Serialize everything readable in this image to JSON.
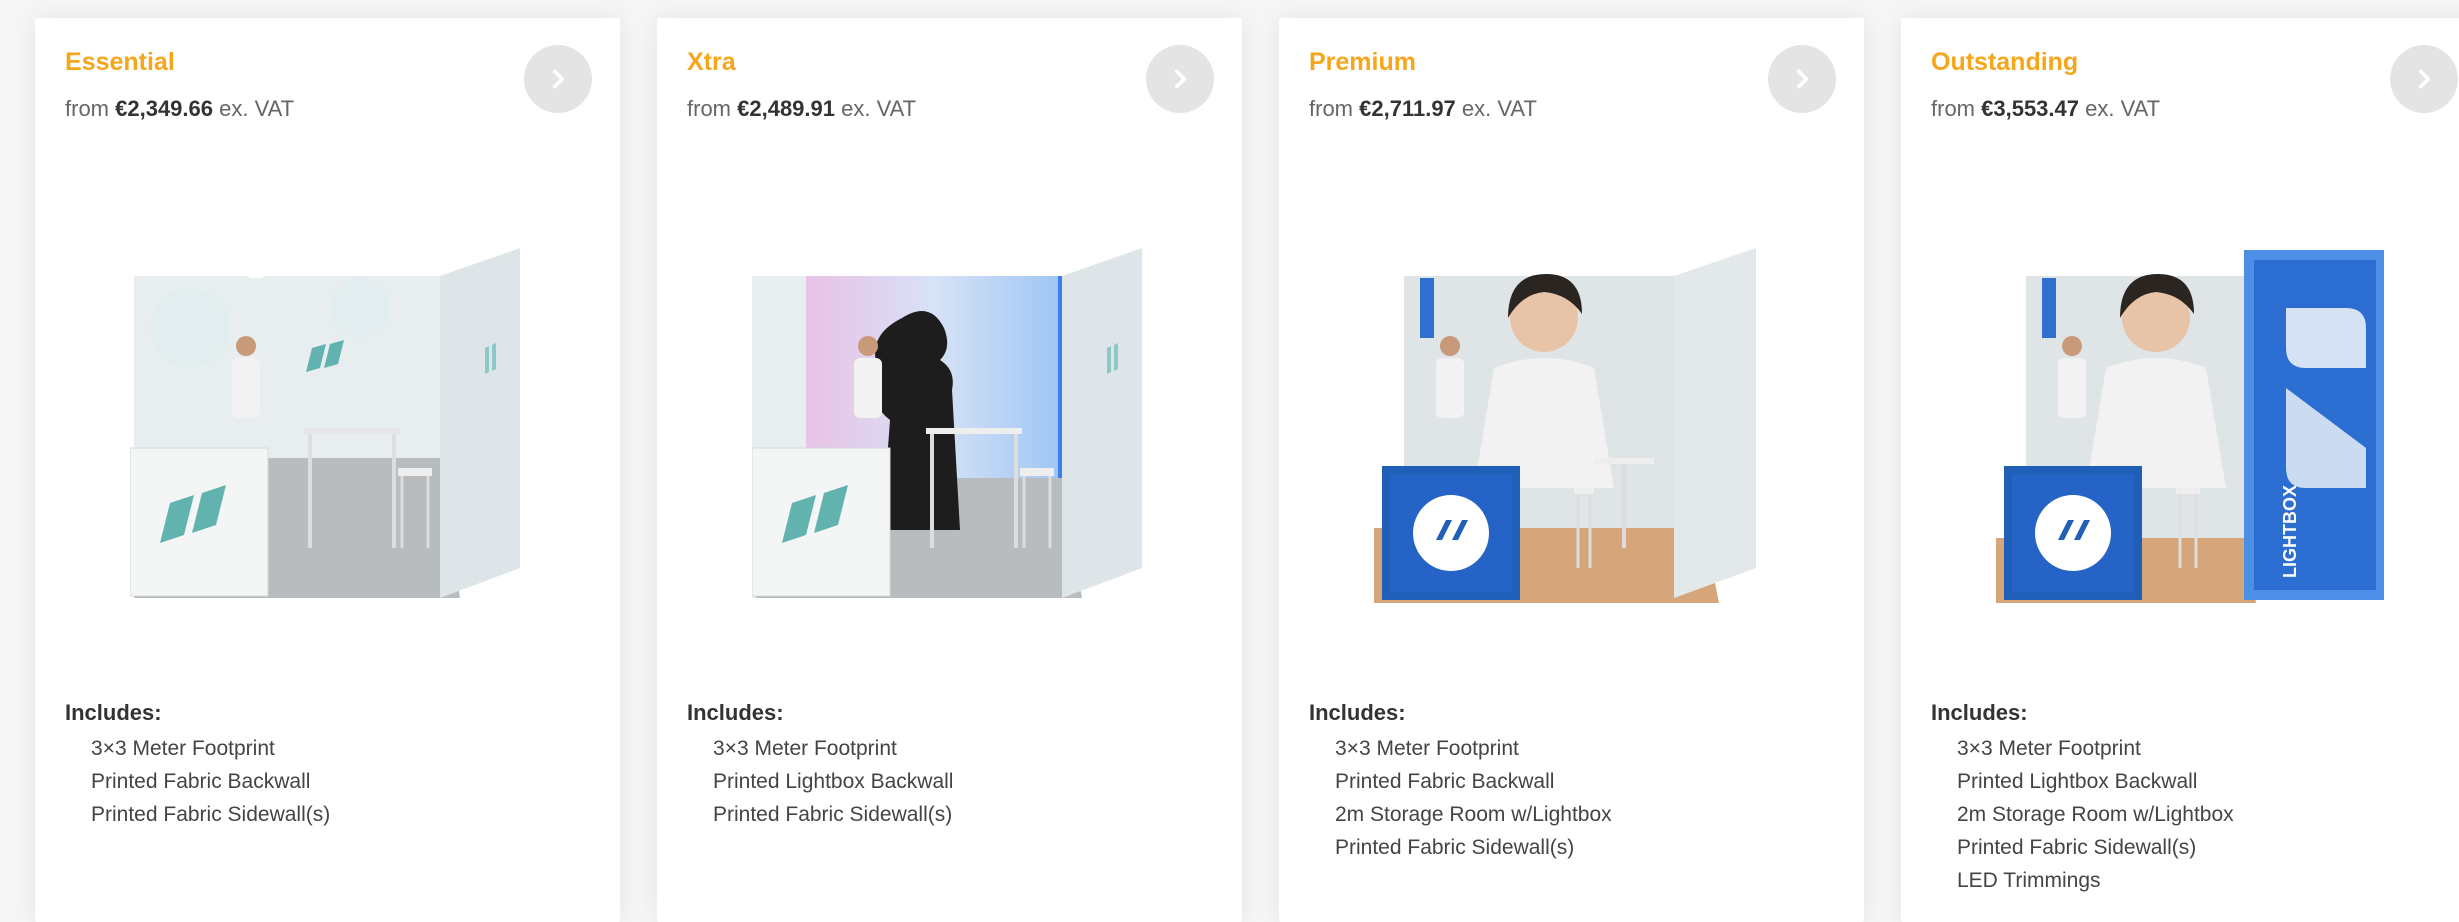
{
  "colors": {
    "accent": "#f6a61a",
    "card_bg": "#ffffff",
    "button_bg": "#e4e4e4",
    "fabric_teal": "#62b3b0",
    "brand_blue": "#1f5fb8"
  },
  "cards": [
    {
      "title": "Essential",
      "price_prefix": "from",
      "price_amount": "€2,349.66",
      "price_suffix": "ex. VAT",
      "includes_label": "Includes:",
      "includes": [
        "3×3 Meter Footprint",
        "Printed Fabric Backwall",
        "Printed Fabric Sidewall(s)"
      ]
    },
    {
      "title": "Xtra",
      "price_prefix": "from",
      "price_amount": "€2,489.91",
      "price_suffix": "ex. VAT",
      "includes_label": "Includes:",
      "includes": [
        "3×3 Meter Footprint",
        "Printed Lightbox Backwall",
        "Printed Fabric Sidewall(s)"
      ]
    },
    {
      "title": "Premium",
      "price_prefix": "from",
      "price_amount": "€2,711.97",
      "price_suffix": "ex. VAT",
      "includes_label": "Includes:",
      "includes": [
        "3×3 Meter Footprint",
        "Printed Fabric Backwall",
        "2m Storage Room w/Lightbox",
        "Printed Fabric Sidewall(s)"
      ]
    },
    {
      "title": "Outstanding",
      "price_prefix": "from",
      "price_amount": "€3,553.47",
      "price_suffix": "ex. VAT",
      "includes_label": "Includes:",
      "includes": [
        "3×3 Meter Footprint",
        "Printed Lightbox Backwall",
        "2m Storage Room w/Lightbox",
        "Printed Fabric Sidewall(s)",
        "LED Trimmings"
      ]
    }
  ],
  "booth_labels": {
    "lightbox": "LIGHTBOX"
  }
}
